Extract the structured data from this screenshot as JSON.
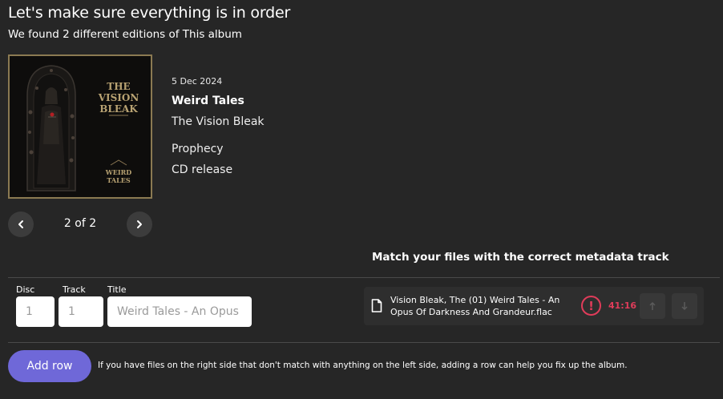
{
  "header": {
    "title": "Let's make sure everything is in order",
    "subtitle": "We found 2 different editions of This album"
  },
  "cover": {
    "logo_line1": "THE",
    "logo_line2": "VISION",
    "logo_line3": "BLEAK",
    "sub_line1": "WEIRD",
    "sub_line2": "TALES",
    "border_color": "#8b7a52"
  },
  "edition": {
    "date": "5 Dec 2024",
    "title": "Weird Tales",
    "artist": "The Vision Bleak",
    "label": "Prophecy",
    "format": "CD release"
  },
  "pager": {
    "text": "2 of 2",
    "prev_icon": "chevron-left-icon",
    "next_icon": "chevron-right-icon"
  },
  "match": {
    "heading": "Match your files with the correct metadata track"
  },
  "track_row": {
    "disc_label": "Disc",
    "track_label": "Track",
    "title_label": "Title",
    "disc_placeholder": "1",
    "track_placeholder": "1",
    "title_placeholder": "Weird Tales - An Opus Of Darkness And Grandeur"
  },
  "file": {
    "name": "Vision Bleak, The (01) Weird Tales - An Opus Of Darkness And Grandeur.flac",
    "warning_symbol": "!",
    "duration": "41:16",
    "warning_color": "#e03c5a",
    "up_icon": "arrow-up-icon",
    "down_icon": "arrow-down-icon"
  },
  "footer": {
    "add_row_label": "Add row",
    "hint": "If you have files on the right side that don't match with anything on the left side, adding a row can help you fix up the album.",
    "accent": "#6f68d8"
  }
}
